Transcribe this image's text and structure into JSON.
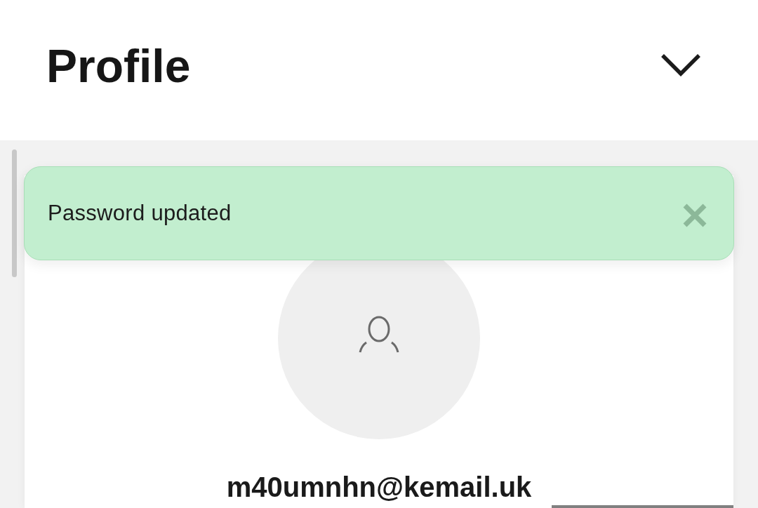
{
  "header": {
    "title": "Profile"
  },
  "toast": {
    "message": "Password updated"
  },
  "profile": {
    "email": "m40umnhn@kemail.uk"
  }
}
